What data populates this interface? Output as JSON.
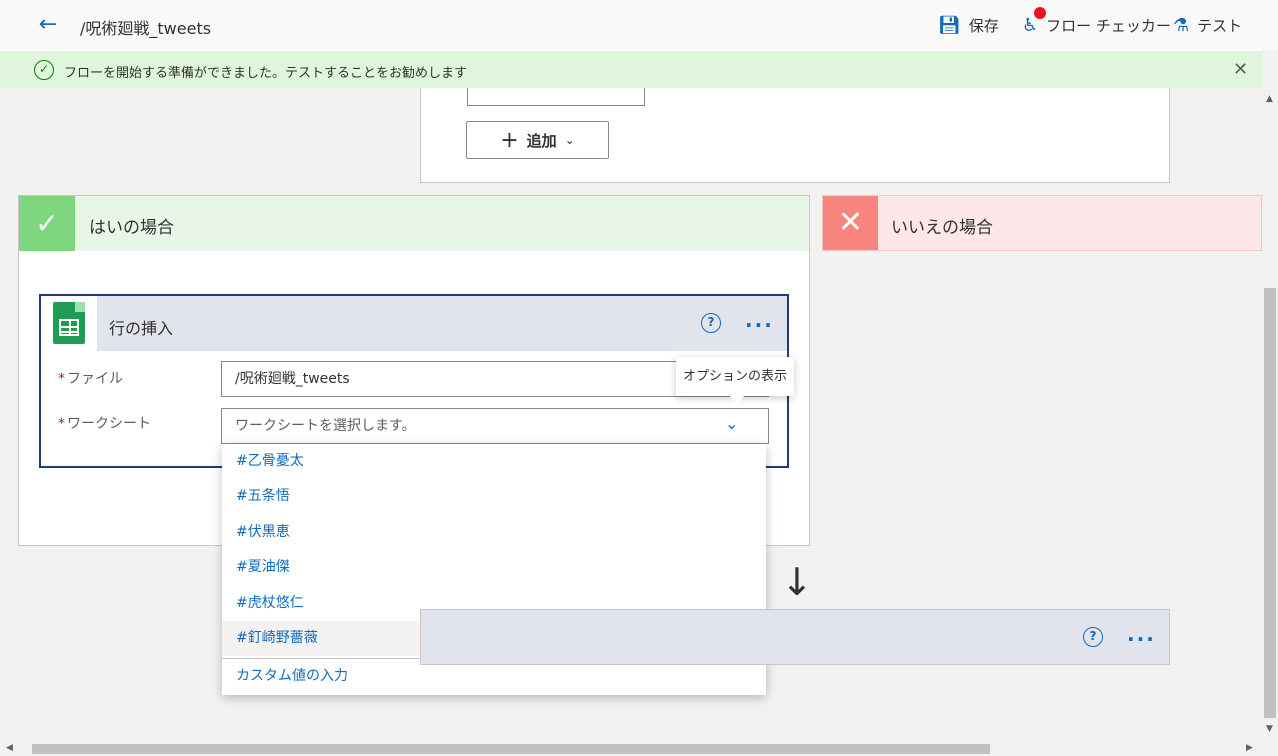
{
  "header": {
    "flow_title": "/呪術廻戦_tweets",
    "save_label": "保存",
    "checker_label": "フロー チェッカー",
    "test_label": "テスト"
  },
  "banner": {
    "message": "フローを開始する準備ができました。テストすることをお勧めします"
  },
  "condition": {
    "add_label": "追加"
  },
  "branches": {
    "yes_label": "はいの場合",
    "no_label": "いいえの場合"
  },
  "action": {
    "title": "行の挿入",
    "file_label": "ファイル",
    "file_value": "/呪術廻戦_tweets",
    "worksheet_label": "ワークシート",
    "worksheet_placeholder": "ワークシートを選択します。"
  },
  "tooltip": {
    "text": "オプションの表示"
  },
  "dropdown": {
    "items": [
      "#乙骨憂太",
      "#五条悟",
      "#伏黒恵",
      "#夏油傑",
      "#虎杖悠仁",
      "#釘崎野薔薇"
    ],
    "custom_label": "カスタム値の入力"
  },
  "colors": {
    "accent": "#0f6cbd",
    "success_banner": "#dff6dd",
    "yes_header": "#e8f6e8",
    "no_header": "#fde7e9",
    "action_border": "#203b79"
  }
}
